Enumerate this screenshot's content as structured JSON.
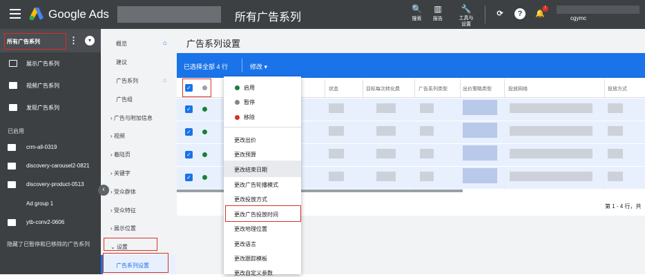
{
  "header": {
    "brand": "Google Ads",
    "page_title": "所有广告系列",
    "tools": [
      {
        "icon": "search-icon",
        "label": "搜索"
      },
      {
        "icon": "report-icon",
        "label": "报告"
      },
      {
        "icon": "wrench-icon",
        "label": "工具与\n设置"
      }
    ],
    "notification_count": "!",
    "account_name": "cgymc"
  },
  "sidebar": {
    "title": "所有广告系列",
    "items": [
      {
        "icon": "display-campaign-icon",
        "label": "展示广告系列"
      },
      {
        "icon": "video-campaign-icon",
        "label": "视频广告系列"
      },
      {
        "icon": "discovery-campaign-icon",
        "label": "发现广告系列"
      }
    ],
    "section_label": "已启用",
    "enabled": [
      {
        "icon": "display-campaign-icon",
        "label": "crm-all-0319"
      },
      {
        "icon": "discovery-campaign-icon",
        "label": "discovery-carousel2-0821"
      },
      {
        "icon": "discovery-campaign-icon",
        "label": "discovery-product-0513"
      },
      {
        "icon": "",
        "label": "Ad group 1"
      },
      {
        "icon": "video-campaign-icon",
        "label": "ytb-conv2-0606"
      }
    ],
    "footer": "隐藏了已暂停和已移除的广告系列"
  },
  "subnav": {
    "items": [
      {
        "label": "概览",
        "arrow": false
      },
      {
        "label": "建议",
        "arrow": false
      },
      {
        "label": "广告系列",
        "arrow": false
      },
      {
        "label": "广告组",
        "arrow": false
      },
      {
        "label": "广告与附加信息",
        "arrow": true
      },
      {
        "label": "视频",
        "arrow": true
      },
      {
        "label": "着陆页",
        "arrow": true
      },
      {
        "label": "关键字",
        "arrow": true
      },
      {
        "label": "受众群体",
        "arrow": true
      },
      {
        "label": "受众特征",
        "arrow": true
      },
      {
        "label": "展示位置",
        "arrow": true
      },
      {
        "label": "设置",
        "arrow": true
      }
    ],
    "active": "广告系列设置"
  },
  "main": {
    "title": "广告系列设置",
    "selection": "已选择全部 4 行",
    "edit_label": "修改 ▾",
    "columns": [
      "状态",
      "目标每次转化费",
      "广告系列类型",
      "出价策略类型",
      "投放网络",
      "投放方式"
    ],
    "pagination": "第 1 - 4 行，共"
  },
  "dropdown": {
    "status": [
      {
        "label": "启用",
        "color": "#188038"
      },
      {
        "label": "暂停",
        "color": "#80868b"
      },
      {
        "label": "移除",
        "color": "#d93025"
      }
    ],
    "actions": [
      "更改出价",
      "更改预算",
      "更改结束日期",
      "更改广告轮播模式",
      "更改投放方式",
      "更改广告投放时间",
      "更改地理位置",
      "更改语言",
      "更改跟踪模板",
      "更改自定义参数"
    ]
  }
}
